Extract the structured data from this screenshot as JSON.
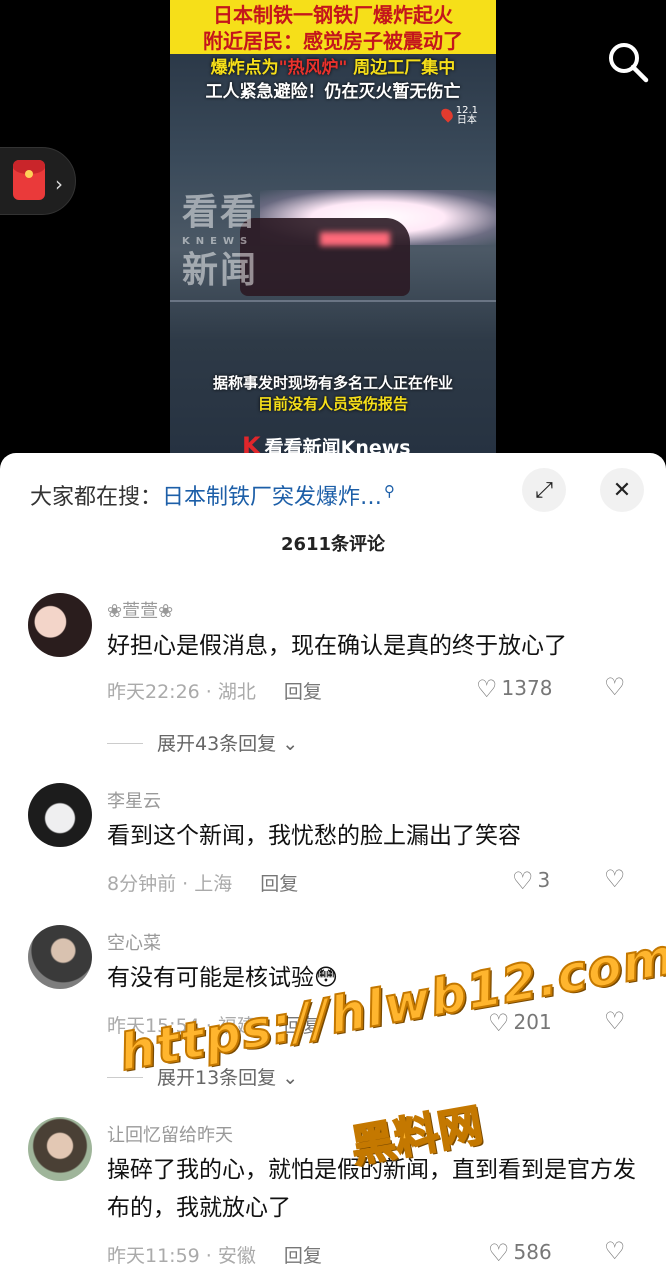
{
  "video": {
    "title_line1": "日本制铁一钢铁厂爆炸起火",
    "title_line2": "附近居民：感觉房子被震动了",
    "sub_line1_a": "爆炸点为",
    "sub_line1_b": "\"热风炉\"",
    "sub_line1_c": "  周边工厂集中",
    "sub_line2": "工人紧急避险！仍在灭火暂无伤亡",
    "loc_date": "12.1",
    "loc_place": "日本",
    "watermark_line1": "看看",
    "watermark_small": "KNEWS",
    "watermark_line2": "新闻",
    "caption1": "据称事发时现场有多名工人正在作业",
    "caption2": "目前没有人员受伤报告",
    "brand": "看看新闻Knews",
    "brand_k": "K"
  },
  "overlay": {
    "search_icon": "search-icon",
    "red_packet_icon": "red-packet-icon",
    "chevron": "›"
  },
  "sheet": {
    "hot_search_label": "大家都在搜：",
    "hot_search_query": "日本制铁厂突发爆炸…",
    "expand_icon": "⤢",
    "close_icon": "✕",
    "comment_count": "2611条评论"
  },
  "comments": [
    {
      "username": "❀萱萱❀",
      "text": "好担心是假消息，现在确认是真的终于放心了",
      "time_location": "昨天22:26 · 湖北",
      "reply": "回复",
      "likes": "1378",
      "expand": "展开43条回复 ⌄"
    },
    {
      "username": "李星云",
      "text": "看到这个新闻，我忧愁的脸上漏出了笑容",
      "time_location": "8分钟前 · 上海",
      "reply": "回复",
      "likes": "3"
    },
    {
      "username": "空心菜",
      "text": "有没有可能是核试验😳",
      "time_location": "昨天15:54 · 福建",
      "reply": "回复",
      "likes": "201",
      "expand": "展开13条回复 ⌄"
    },
    {
      "username": "让回忆留给昨天",
      "text": "操碎了我的心，就怕是假的新闻，直到看到是官方发布的，我就放心了",
      "time_location": "昨天11:59 · 安徽",
      "reply": "回复",
      "likes": "586"
    }
  ],
  "watermark": {
    "url": "https://hlwb12.com",
    "name": "黑料网"
  },
  "colors": {
    "title_bg": "#f6df19",
    "title_text": "#c4161c",
    "link": "#1d5fa8",
    "watermark": "#ffb52e"
  }
}
